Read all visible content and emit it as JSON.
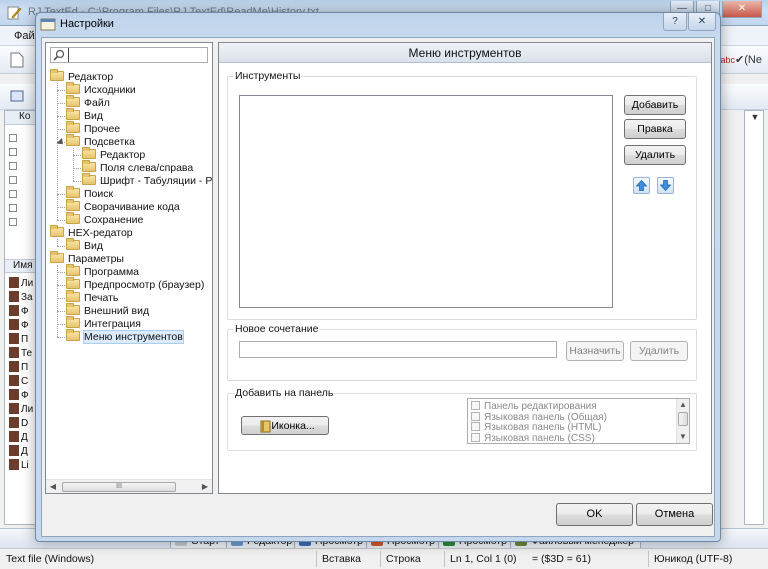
{
  "background_window": {
    "title": "RJ TextEd - C:\\Program Files\\RJ TextEd\\ReadMe\\History.txt",
    "menu_file": "Файл",
    "toolbar_spell": "(Ne",
    "panel_header": "Ко",
    "names_header": "Имя",
    "tabs": [
      {
        "label": "Старт",
        "color": "#c0c8d0"
      },
      {
        "label": "Редактор",
        "color": "#6f9bd1"
      },
      {
        "label": "Просмотр",
        "color": "#3c6fb8"
      },
      {
        "label": "Просмотр",
        "color": "#d35a2a"
      },
      {
        "label": "Просмотр",
        "color": "#2c8a3a"
      },
      {
        "label": "Файловый менеджер",
        "color": "#6a8a3a"
      }
    ],
    "status": {
      "file_type": "Text file (Windows)",
      "mode": "Вставка",
      "line_label": "Строка",
      "position": "Ln 1, Col 1 (0)",
      "char_code": "= ($3D = 61)",
      "encoding": "Юникод (UTF-8)"
    },
    "left_file_labels": [
      "Ли",
      "За",
      "Ф",
      "Ф",
      "П",
      "Те",
      "П",
      "С",
      "Ф",
      "Ли",
      "D",
      "Д",
      "Д",
      "Li"
    ]
  },
  "dialog": {
    "title": "Настройки",
    "help_glyph": "?",
    "close_glyph": "✕",
    "search_placeholder": "",
    "tree": [
      {
        "label": "Редактор",
        "level": 0
      },
      {
        "label": "Исходники",
        "level": 1
      },
      {
        "label": "Файл",
        "level": 1
      },
      {
        "label": "Вид",
        "level": 1
      },
      {
        "label": "Прочее",
        "level": 1
      },
      {
        "label": "Подсветка",
        "level": 1
      },
      {
        "label": "Редактор",
        "level": 2
      },
      {
        "label": "Поля слева/справа",
        "level": 2
      },
      {
        "label": "Шрифт - Табуляции - Разде",
        "level": 2
      },
      {
        "label": "Поиск",
        "level": 1
      },
      {
        "label": "Сворачивание кода",
        "level": 1
      },
      {
        "label": "Сохранение",
        "level": 1
      },
      {
        "label": "HEX-редатор",
        "level": 0
      },
      {
        "label": "Вид",
        "level": 1
      },
      {
        "label": "Параметры",
        "level": 0
      },
      {
        "label": "Программа",
        "level": 1
      },
      {
        "label": "Предпросмотр (браузер)",
        "level": 1
      },
      {
        "label": "Печать",
        "level": 1
      },
      {
        "label": "Внешний вид",
        "level": 1
      },
      {
        "label": "Интеграция",
        "level": 1
      },
      {
        "label": "Меню инструментов",
        "level": 1
      }
    ],
    "selected_index": 20,
    "scroll_thumb_glyph": "III",
    "panel": {
      "header": "Меню инструментов",
      "tools_group": "Инструменты",
      "add_button": "Добавить",
      "edit_button": "Правка",
      "delete_button": "Удалить",
      "hotkey_group": "Новое сочетание",
      "hotkey_value": "",
      "assign_button": "Назначить",
      "hotkey_delete_button": "Удалить",
      "toolbar_group": "Добавить на панель",
      "icon_button": "Иконка...",
      "toolbar_checklist": [
        "Панель редактирования",
        "Языковая панель (Общая)",
        "Языковая панель (HTML)",
        "Языковая панель (CSS)"
      ]
    },
    "ok_button": "OK",
    "cancel_button": "Отмена"
  }
}
